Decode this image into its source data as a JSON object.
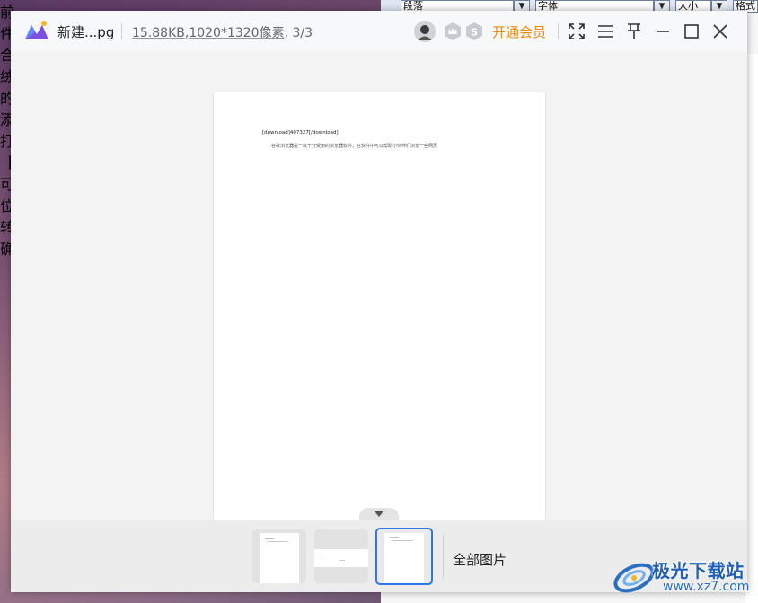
{
  "background_editor": {
    "toolbar": {
      "style_box": "段落",
      "font_box": "字体",
      "size_box": "大小",
      "format_box": "格式"
    },
    "peek_chars": [
      "前",
      "件",
      "合",
      "绒",
      "的",
      "添",
      "打",
      "【",
      "可",
      "位",
      "转",
      "确"
    ]
  },
  "viewer": {
    "title": {
      "file_name": "新建...pg",
      "file_size": "15.88KB",
      "dimensions": ",1020*1320像素",
      "position": ", 3/3",
      "vip_label": "开通会员"
    },
    "icons": {
      "avatar": "user-avatar",
      "crown": "crown-badge-icon",
      "svip": "s-badge-icon",
      "fullscreen": "fullscreen-icon",
      "menu": "menu-icon",
      "pin": "pin-icon",
      "minimize": "minimize-icon",
      "maximize": "maximize-icon",
      "close": "close-icon"
    },
    "document": {
      "heading": "[download]407327[/download]",
      "body": "谷歌浏览器是一款十分受用的浏览器软件，在软件中可以帮助小伙伴们浏览一些网页"
    },
    "filmstrip": {
      "all_images_label": "全部图片",
      "thumbnails": [
        {
          "index": 1,
          "active": false
        },
        {
          "index": 2,
          "active": false
        },
        {
          "index": 3,
          "active": true
        }
      ]
    }
  },
  "watermark": {
    "text": "极光下载站",
    "url": "www.xz7.com"
  },
  "colors": {
    "accent": "#2f76e6",
    "vip": "#f08a16",
    "watermark": "#1f5fb8"
  }
}
